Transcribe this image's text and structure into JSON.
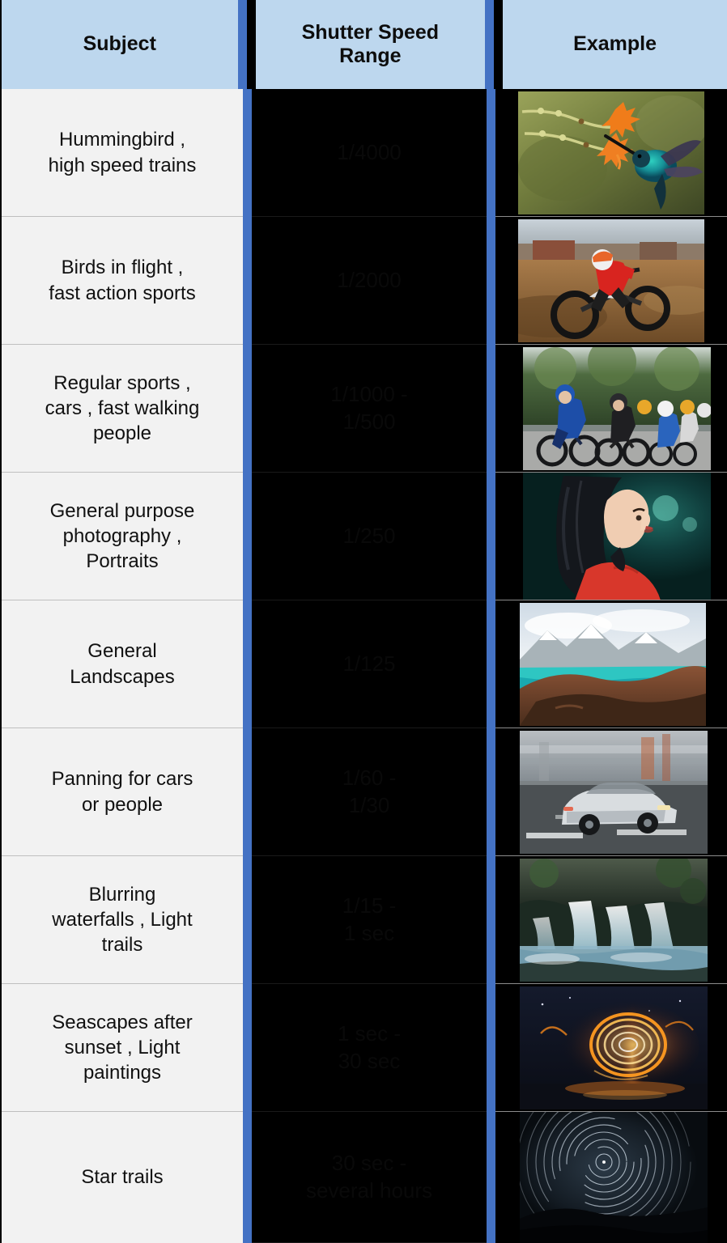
{
  "table": {
    "headers": {
      "subject": "Subject",
      "shutter_speed_range": "Shutter Speed\nRange",
      "example": "Example"
    },
    "colors": {
      "header_background": "#bdd7ee",
      "divider": "#4472c4",
      "subject_cell_background": "#f2f2f2",
      "speed_cell_background": "#000000",
      "example_cell_background": "#000000",
      "subject_text": "#111111",
      "speed_text": "#090909"
    },
    "rows": [
      {
        "subject": "Hummingbird ,\nhigh speed trains",
        "shutter_speed_range": "1/4000",
        "example_alt": "hummingbird-in-flight-photo"
      },
      {
        "subject": "Birds in flight ,\nfast action sports",
        "shutter_speed_range": "1/2000",
        "example_alt": "motocross-rider-photo"
      },
      {
        "subject": "Regular sports ,\ncars , fast walking\npeople",
        "shutter_speed_range": "1/1000 -\n1/500",
        "example_alt": "cycling-peloton-photo"
      },
      {
        "subject": "General purpose\nphotography ,\nPortraits",
        "shutter_speed_range": "1/250",
        "example_alt": "portrait-woman-red-top-photo"
      },
      {
        "subject": "General\nLandscapes",
        "shutter_speed_range": "1/125",
        "example_alt": "mountain-lake-landscape-photo"
      },
      {
        "subject": "Panning for cars\nor people",
        "shutter_speed_range": "1/60 -\n1/30",
        "example_alt": "panning-car-motion-blur-photo"
      },
      {
        "subject": "Blurring\nwaterfalls , Light\ntrails",
        "shutter_speed_range": "1/15 -\n1 sec",
        "example_alt": "long-exposure-waterfall-photo"
      },
      {
        "subject": "Seascapes after\nsunset , Light\npaintings",
        "shutter_speed_range": "1 sec -\n30 sec",
        "example_alt": "light-painting-steel-wool-photo"
      },
      {
        "subject": "Star trails",
        "shutter_speed_range": "30 sec -\nseveral hours",
        "example_alt": "star-trails-night-sky-photo"
      }
    ]
  }
}
